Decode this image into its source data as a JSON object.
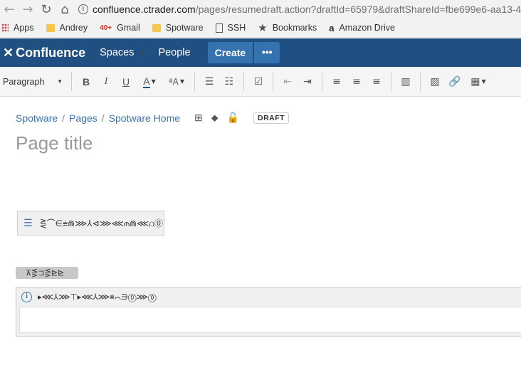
{
  "browser": {
    "url_host": "confluence.ctrader.com",
    "url_path": "/pages/resumedraft.action?draftId=65979&draftShareId=fbe699e6-aa13-4",
    "bookmarks": [
      "Apps",
      "Andrey",
      "Gmail",
      "Spotware",
      "SSH",
      "Bookmarks",
      "Amazon Drive"
    ],
    "gmail_badge": "40+"
  },
  "nav": {
    "logo": "Confluence",
    "spaces": "Spaces",
    "people": "People",
    "create": "Create",
    "more": "•••"
  },
  "toolbar": {
    "format": "Paragraph",
    "bold": "B",
    "italic": "I",
    "underline": "U",
    "color": "A",
    "more_format": "ªA"
  },
  "breadcrumb": [
    "Spotware",
    "Pages",
    "Spotware Home"
  ],
  "draft_label": "DRAFT",
  "page_title_placeholder": "Page title",
  "toc_label": "⋛⌒∈⩧⋒⋙⅄⊲⋙⋘⫙⋒⋘⩍⓪",
  "status_label": "⊼⋚⊐⋚⊵⊵",
  "info_label": "▸⋘⅄⋙⊤▸⋘⅄⋙⩧⌒∋⓪⋙⓪",
  "colors": {
    "nav_bg": "#205081",
    "create_bg": "#3572b0",
    "link": "#3b73af"
  }
}
